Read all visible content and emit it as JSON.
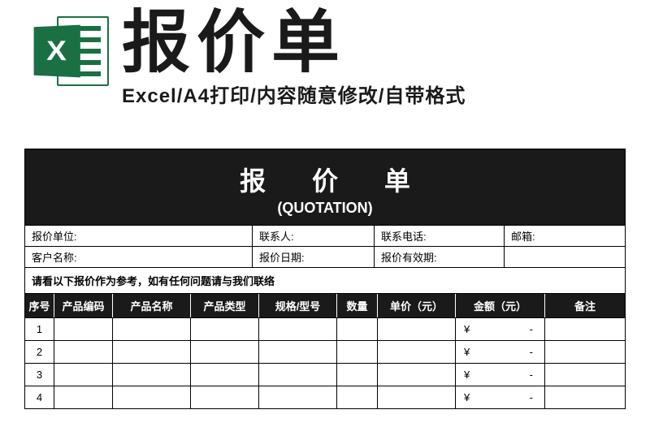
{
  "header": {
    "big_title": "报价单",
    "sub_title": "Excel/A4打印/内容随意修改/自带格式",
    "excel_x": "X"
  },
  "doc": {
    "title_cn": "报 价 单",
    "title_en": "(QUOTATION)",
    "meta1": {
      "unit": "报价单位:",
      "contact": "联系人:",
      "phone": "联系电话:",
      "email": "邮箱:"
    },
    "meta2": {
      "customer": "客户名称:",
      "date": "报价日期:",
      "valid": "报价有效期:",
      "blank": ""
    },
    "note": "请看以下报价作为参考，如有任何问题请与我们联络",
    "cols": {
      "seq": "序号",
      "code": "产品编码",
      "name": "产品名称",
      "type": "产品类型",
      "spec": "规格/型号",
      "qty": "数量",
      "price": "单价（元）",
      "amt": "金额（元）",
      "rem": "备注"
    },
    "rows": [
      {
        "seq": "1",
        "cur": "¥",
        "dash": "-"
      },
      {
        "seq": "2",
        "cur": "¥",
        "dash": "-"
      },
      {
        "seq": "3",
        "cur": "¥",
        "dash": "-"
      },
      {
        "seq": "4",
        "cur": "¥",
        "dash": "-"
      }
    ]
  }
}
